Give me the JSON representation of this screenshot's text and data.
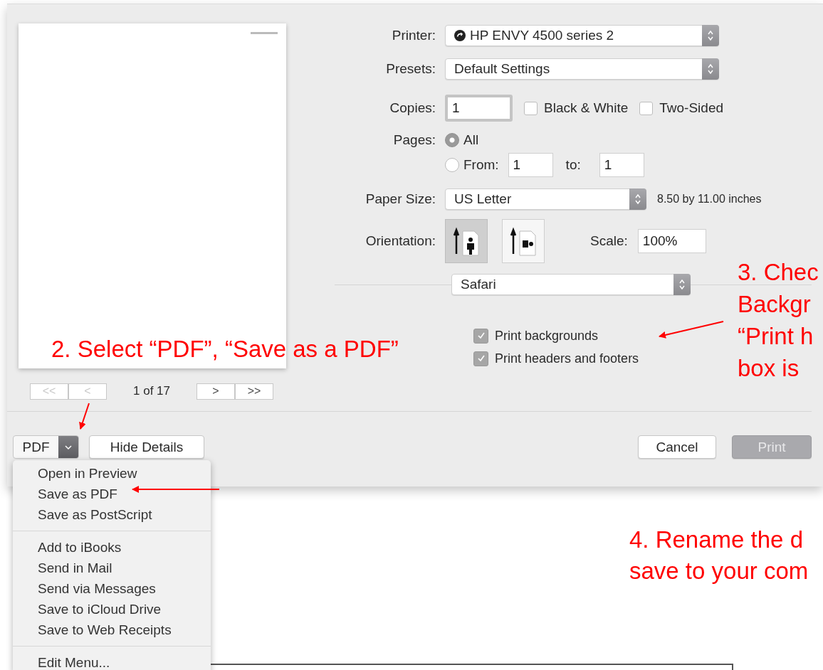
{
  "preview": {
    "page_label": "1 of 17",
    "nav_buttons": [
      {
        "label": "<<",
        "disabled": true
      },
      {
        "label": "<",
        "disabled": true
      },
      {
        "label": ">",
        "disabled": false
      },
      {
        "label": ">>",
        "disabled": false
      }
    ]
  },
  "form": {
    "printer": {
      "label": "Printer:",
      "value": "HP ENVY 4500 series 2"
    },
    "presets": {
      "label": "Presets:",
      "value": "Default Settings"
    },
    "copies": {
      "label": "Copies:",
      "value": "1"
    },
    "copy_options": [
      {
        "label": "Black & White",
        "checked": false
      },
      {
        "label": "Two-Sided",
        "checked": false
      }
    ],
    "pages": {
      "label": "Pages:",
      "all": {
        "label": "All",
        "selected": true
      },
      "range": {
        "label": "From:",
        "selected": false,
        "from": "1",
        "to_label": "to:",
        "to": "1"
      }
    },
    "paper_size": {
      "label": "Paper Size:",
      "value": "US Letter",
      "note": "8.50 by 11.00 inches"
    },
    "orientation": {
      "label": "Orientation:",
      "options": [
        {
          "kind": "portrait",
          "selected": true
        },
        {
          "kind": "landscape",
          "selected": false
        }
      ]
    },
    "scale": {
      "label": "Scale:",
      "value": "100%"
    },
    "section": {
      "value": "Safari"
    },
    "options": [
      {
        "label": "Print backgrounds",
        "checked": true
      },
      {
        "label": "Print headers and footers",
        "checked": true
      }
    ]
  },
  "footer": {
    "pdf_button": "PDF",
    "hide_details": "Hide Details",
    "cancel": "Cancel",
    "print": {
      "label": "Print",
      "disabled": true
    }
  },
  "pdf_menu": {
    "groups": [
      {
        "items": [
          "Open in Preview",
          "Save as PDF",
          "Save as PostScript"
        ]
      },
      {
        "items": [
          "Add to iBooks",
          "Send in Mail",
          "Send via Messages",
          "Save to iCloud Drive",
          "Save to Web Receipts"
        ]
      },
      {
        "items": [
          "Edit Menu..."
        ]
      }
    ]
  },
  "annotations": [
    {
      "lines": [
        "2. Select “PDF”, “Save as a PDF”"
      ]
    },
    {
      "lines": [
        "3. Chec",
        "Backgr",
        "“Print h",
        "box is"
      ]
    },
    {
      "lines": [
        "4. Rename the d",
        "save to your com"
      ]
    }
  ]
}
